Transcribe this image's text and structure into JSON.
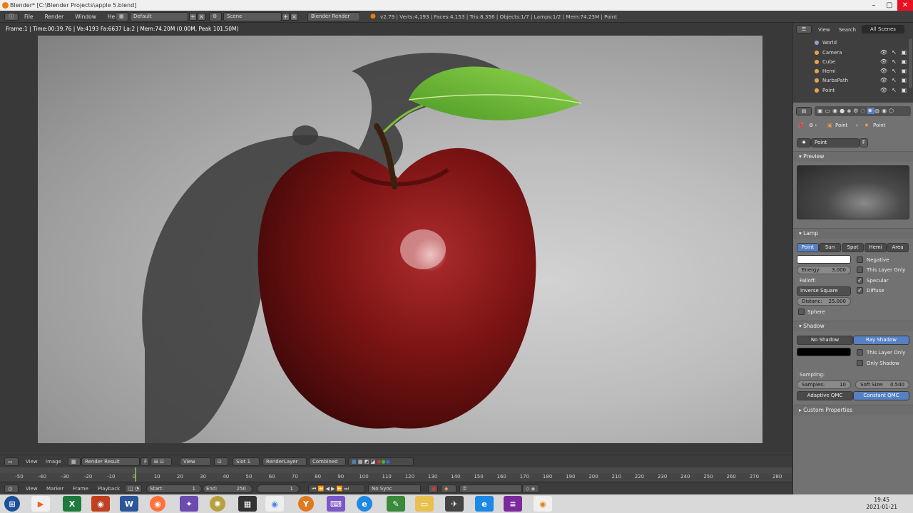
{
  "window": {
    "title": "Blender* [C:\\Blender Projects\\apple 5.blend]"
  },
  "menu": [
    "File",
    "Render",
    "Window",
    "Help"
  ],
  "layout": "Default",
  "scene": "Scene",
  "engine": "Blender Render",
  "stats": "v2.79 | Verts:4,193 | Faces:4,153 | Tris:8,356 | Objects:1/7 | Lamps:1/2 | Mem:74.23M | Point",
  "render_info": "Frame:1 | Time:00:39.76 | Ve:4193 Fa:6637 La:2 | Mem:74.20M (0.00M, Peak 101.50M)",
  "image_header": {
    "view": "View",
    "image": "Image",
    "result": "Render Result",
    "f": "F",
    "view2": "View",
    "slot": "Slot 1",
    "layer": "RenderLayer",
    "pass": "Combined"
  },
  "timeline": {
    "ticks": [
      "-50",
      "-40",
      "-30",
      "-20",
      "-10",
      "0",
      "10",
      "20",
      "30",
      "40",
      "50",
      "60",
      "70",
      "80",
      "90",
      "100",
      "110",
      "120",
      "130",
      "140",
      "150",
      "160",
      "170",
      "180",
      "190",
      "200",
      "210",
      "220",
      "230",
      "240",
      "250",
      "260",
      "270",
      "280"
    ],
    "current_frame": 1,
    "start_label": "Start:",
    "start": "1",
    "end_label": "End:",
    "end": "250",
    "frame": "1",
    "sync": "No Sync",
    "menus": [
      "View",
      "Marker",
      "Frame",
      "Playback"
    ]
  },
  "outliner": {
    "tabs": [
      "View",
      "Search",
      "All Scenes"
    ],
    "items": [
      {
        "name": "World",
        "icon": "world-icon",
        "color": "#8aa2c8"
      },
      {
        "name": "Camera",
        "icon": "camera-icon",
        "color": "#e6a04a"
      },
      {
        "name": "Cube",
        "icon": "mesh-icon",
        "color": "#e6a04a"
      },
      {
        "name": "Hemi",
        "icon": "lamp-icon",
        "color": "#e6a04a"
      },
      {
        "name": "NurbsPath",
        "icon": "curve-icon",
        "color": "#e6a04a"
      },
      {
        "name": "Point",
        "icon": "lamp-icon",
        "color": "#e6a04a"
      }
    ]
  },
  "properties": {
    "breadcrumb": [
      "Point",
      "Point"
    ],
    "datablock": "Point",
    "datablock_f": "F",
    "preview_header": "Preview",
    "lamp_header": "Lamp",
    "lamp_types": [
      "Point",
      "Sun",
      "Spot",
      "Hemi",
      "Area"
    ],
    "lamp_type_active": "Point",
    "energy_label": "Energy:",
    "energy": "3.000",
    "falloff_label": "Falloff:",
    "falloff": "Inverse Square",
    "distance_label": "Distanc:",
    "distance": "25.000",
    "sphere": "Sphere",
    "negative": "Negative",
    "this_layer_only": "This Layer Only",
    "specular": "Specular",
    "diffuse": "Diffuse",
    "shadow_header": "Shadow",
    "shadow_types": [
      "No Shadow",
      "Ray Shadow"
    ],
    "shadow_active": "Ray Shadow",
    "shadow_this_layer": "This Layer Only",
    "only_shadow": "Only Shadow",
    "sampling_label": "Sampling:",
    "samples_label": "Samples:",
    "samples": "10",
    "soft_size_label": "Soft Size:",
    "soft_size": "0.500",
    "qmc": [
      "Adaptive QMC",
      "Constant QMC"
    ],
    "qmc_active": "Constant QMC",
    "custom_props": "Custom Properties"
  },
  "clock": {
    "time": "19:45",
    "date": "2021-01-21"
  },
  "colors": {
    "accent": "#5680c2",
    "apple": "#8a1414",
    "leaf": "#6fbf3a"
  }
}
